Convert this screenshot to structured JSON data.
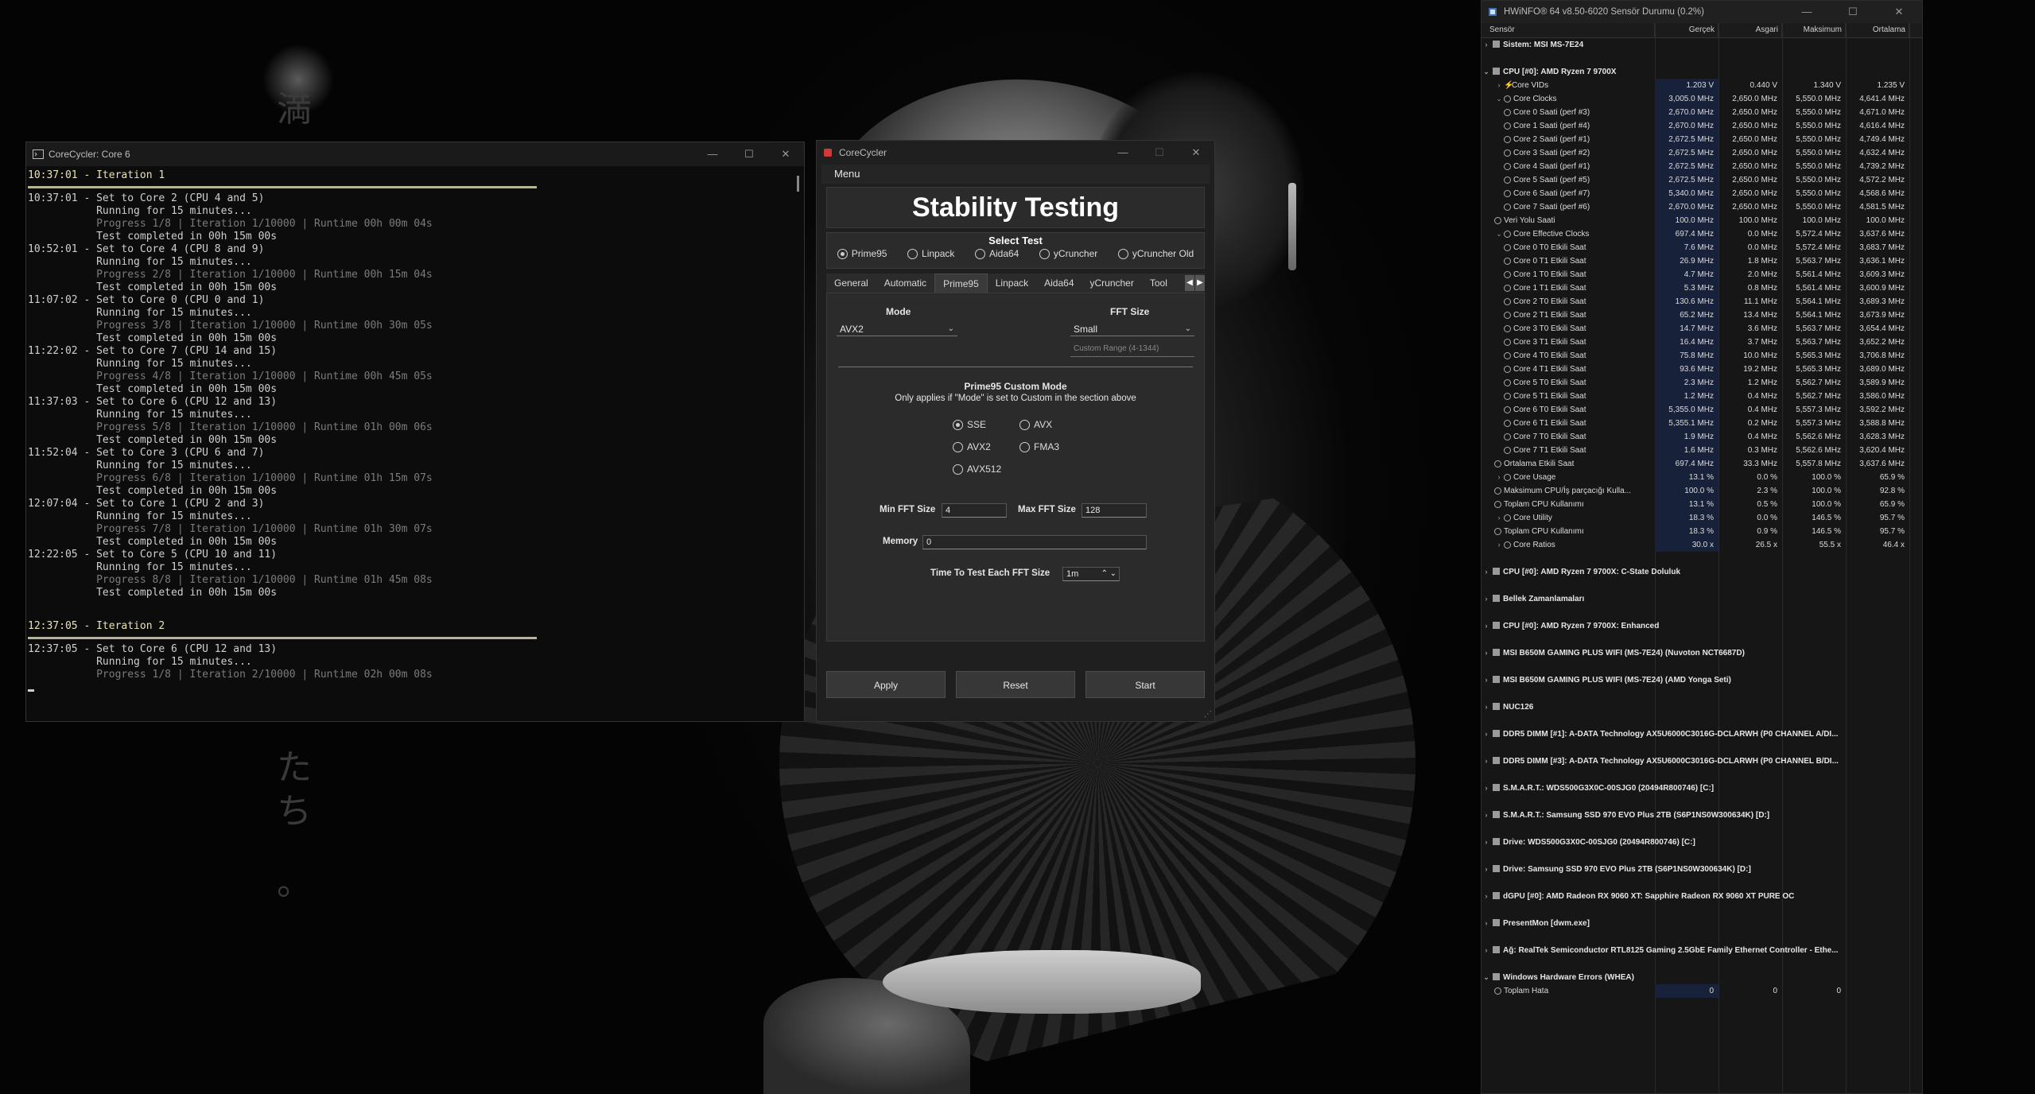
{
  "wallpaper": {
    "kanji": [
      "満",
      "た",
      "ち",
      "。"
    ]
  },
  "console": {
    "title": "CoreCycler: Core 6",
    "blocks": [
      {
        "type": "iter",
        "text": "10:37:01 - Iteration 1"
      },
      {
        "type": "sep"
      },
      {
        "type": "line",
        "text": "10:37:01 - Set to Core 2 (CPU 4 and 5)"
      },
      {
        "type": "line",
        "text": "           Running for 15 minutes..."
      },
      {
        "type": "dim",
        "text": "           Progress 1/8 | Iteration 1/10000 | Runtime 00h 00m 04s"
      },
      {
        "type": "line",
        "text": "           Test completed in 00h 15m 00s"
      },
      {
        "type": "line",
        "text": "10:52:01 - Set to Core 4 (CPU 8 and 9)"
      },
      {
        "type": "line",
        "text": "           Running for 15 minutes..."
      },
      {
        "type": "dim",
        "text": "           Progress 2/8 | Iteration 1/10000 | Runtime 00h 15m 04s"
      },
      {
        "type": "line",
        "text": "           Test completed in 00h 15m 00s"
      },
      {
        "type": "line",
        "text": "11:07:02 - Set to Core 0 (CPU 0 and 1)"
      },
      {
        "type": "line",
        "text": "           Running for 15 minutes..."
      },
      {
        "type": "dim",
        "text": "           Progress 3/8 | Iteration 1/10000 | Runtime 00h 30m 05s"
      },
      {
        "type": "line",
        "text": "           Test completed in 00h 15m 00s"
      },
      {
        "type": "line",
        "text": "11:22:02 - Set to Core 7 (CPU 14 and 15)"
      },
      {
        "type": "line",
        "text": "           Running for 15 minutes..."
      },
      {
        "type": "dim",
        "text": "           Progress 4/8 | Iteration 1/10000 | Runtime 00h 45m 05s"
      },
      {
        "type": "line",
        "text": "           Test completed in 00h 15m 00s"
      },
      {
        "type": "line",
        "text": "11:37:03 - Set to Core 6 (CPU 12 and 13)"
      },
      {
        "type": "line",
        "text": "           Running for 15 minutes..."
      },
      {
        "type": "dim",
        "text": "           Progress 5/8 | Iteration 1/10000 | Runtime 01h 00m 06s"
      },
      {
        "type": "line",
        "text": "           Test completed in 00h 15m 00s"
      },
      {
        "type": "line",
        "text": "11:52:04 - Set to Core 3 (CPU 6 and 7)"
      },
      {
        "type": "line",
        "text": "           Running for 15 minutes..."
      },
      {
        "type": "dim",
        "text": "           Progress 6/8 | Iteration 1/10000 | Runtime 01h 15m 07s"
      },
      {
        "type": "line",
        "text": "           Test completed in 00h 15m 00s"
      },
      {
        "type": "line",
        "text": "12:07:04 - Set to Core 1 (CPU 2 and 3)"
      },
      {
        "type": "line",
        "text": "           Running for 15 minutes..."
      },
      {
        "type": "dim",
        "text": "           Progress 7/8 | Iteration 1/10000 | Runtime 01h 30m 07s"
      },
      {
        "type": "line",
        "text": "           Test completed in 00h 15m 00s"
      },
      {
        "type": "line",
        "text": "12:22:05 - Set to Core 5 (CPU 10 and 11)"
      },
      {
        "type": "line",
        "text": "           Running for 15 minutes..."
      },
      {
        "type": "dim",
        "text": "           Progress 8/8 | Iteration 1/10000 | Runtime 01h 45m 08s"
      },
      {
        "type": "line",
        "text": "           Test completed in 00h 15m 00s"
      },
      {
        "type": "blank"
      },
      {
        "type": "iter",
        "text": "12:37:05 - Iteration 2"
      },
      {
        "type": "sep"
      },
      {
        "type": "line",
        "text": "12:37:05 - Set to Core 6 (CPU 12 and 13)"
      },
      {
        "type": "line",
        "text": "           Running for 15 minutes..."
      },
      {
        "type": "dim",
        "text": "           Progress 1/8 | Iteration 2/10000 | Runtime 02h 00m 08s"
      }
    ]
  },
  "corecycler": {
    "title": "CoreCycler",
    "menu": "Menu",
    "heading": "Stability Testing",
    "select_test_label": "Select Test",
    "tests": [
      {
        "label": "Prime95",
        "selected": true
      },
      {
        "label": "Linpack",
        "selected": false
      },
      {
        "label": "Aida64",
        "selected": false
      },
      {
        "label": "yCruncher",
        "selected": false
      },
      {
        "label": "yCruncher Old",
        "selected": false
      }
    ],
    "tabs": [
      {
        "label": "General",
        "active": false
      },
      {
        "label": "Automatic",
        "active": false
      },
      {
        "label": "Prime95",
        "active": true
      },
      {
        "label": "Linpack",
        "active": false
      },
      {
        "label": "Aida64",
        "active": false
      },
      {
        "label": "yCruncher",
        "active": false
      },
      {
        "label": "Tool",
        "active": false
      }
    ],
    "mode_label": "Mode",
    "mode_value": "AVX2",
    "fft_label": "FFT Size",
    "fft_value": "Small",
    "custom_range_placeholder": "Custom Range (4-1344)",
    "custom_mode_title": "Prime95 Custom Mode",
    "custom_mode_note": "Only applies if \"Mode\" is set to Custom in the section above",
    "instr": [
      {
        "label": "SSE",
        "selected": true
      },
      {
        "label": "AVX",
        "selected": false
      },
      {
        "label": "AVX2",
        "selected": false
      },
      {
        "label": "FMA3",
        "selected": false
      },
      {
        "label": "AVX512",
        "selected": false
      }
    ],
    "min_fft_label": "Min FFT Size",
    "min_fft_value": "4",
    "max_fft_label": "Max FFT Size",
    "max_fft_value": "128",
    "memory_label": "Memory",
    "memory_value": "0",
    "time_label": "Time To Test Each FFT Size",
    "time_value": "1m",
    "buttons": {
      "apply": "Apply",
      "reset": "Reset",
      "start": "Start"
    }
  },
  "hwinfo": {
    "title": "HWiNFO® 64 v8.50-6020 Sensör Durumu (0.2%)",
    "columns": [
      "Sensör",
      "Gerçek",
      "Asgari",
      "Maksimum",
      "Ortalama"
    ],
    "rows": [
      {
        "kind": "sec",
        "name": "Sistem: MSI MS-7E24",
        "expand": "›"
      },
      {
        "kind": "sec",
        "name": "CPU [#0]: AMD Ryzen 7 9700X",
        "expand": "⌄"
      },
      {
        "kind": "row",
        "indent": 1,
        "icon": "bolt",
        "expand": "›",
        "name": "Core VIDs",
        "vals": [
          "1.203 V",
          "0.440 V",
          "1.340 V",
          "1.235 V"
        ]
      },
      {
        "kind": "row",
        "indent": 1,
        "icon": "clock",
        "expand": "⌄",
        "name": "Core Clocks",
        "vals": [
          "3,005.0 MHz",
          "2,650.0 MHz",
          "5,550.0 MHz",
          "4,641.4 MHz"
        ]
      },
      {
        "kind": "row",
        "indent": 2,
        "icon": "clock",
        "name": "Core 0 Saati (perf #3)",
        "vals": [
          "2,670.0 MHz",
          "2,650.0 MHz",
          "5,550.0 MHz",
          "4,671.0 MHz"
        ]
      },
      {
        "kind": "row",
        "indent": 2,
        "icon": "clock",
        "name": "Core 1 Saati (perf #4)",
        "vals": [
          "2,670.0 MHz",
          "2,650.0 MHz",
          "5,550.0 MHz",
          "4,616.4 MHz"
        ]
      },
      {
        "kind": "row",
        "indent": 2,
        "icon": "clock",
        "name": "Core 2 Saati (perf #1)",
        "vals": [
          "2,672.5 MHz",
          "2,650.0 MHz",
          "5,550.0 MHz",
          "4,749.4 MHz"
        ]
      },
      {
        "kind": "row",
        "indent": 2,
        "icon": "clock",
        "name": "Core 3 Saati (perf #2)",
        "vals": [
          "2,672.5 MHz",
          "2,650.0 MHz",
          "5,550.0 MHz",
          "4,632.4 MHz"
        ]
      },
      {
        "kind": "row",
        "indent": 2,
        "icon": "clock",
        "name": "Core 4 Saati (perf #1)",
        "vals": [
          "2,672.5 MHz",
          "2,650.0 MHz",
          "5,550.0 MHz",
          "4,739.2 MHz"
        ]
      },
      {
        "kind": "row",
        "indent": 2,
        "icon": "clock",
        "name": "Core 5 Saati (perf #5)",
        "vals": [
          "2,672.5 MHz",
          "2,650.0 MHz",
          "5,550.0 MHz",
          "4,572.2 MHz"
        ]
      },
      {
        "kind": "row",
        "indent": 2,
        "icon": "clock",
        "name": "Core 6 Saati (perf #7)",
        "vals": [
          "5,340.0 MHz",
          "2,650.0 MHz",
          "5,550.0 MHz",
          "4,568.6 MHz"
        ]
      },
      {
        "kind": "row",
        "indent": 2,
        "icon": "clock",
        "name": "Core 7 Saati (perf #6)",
        "vals": [
          "2,670.0 MHz",
          "2,650.0 MHz",
          "5,550.0 MHz",
          "4,581.5 MHz"
        ]
      },
      {
        "kind": "row",
        "indent": 1,
        "icon": "clock",
        "name": "Veri Yolu Saati",
        "vals": [
          "100.0 MHz",
          "100.0 MHz",
          "100.0 MHz",
          "100.0 MHz"
        ]
      },
      {
        "kind": "row",
        "indent": 1,
        "icon": "clock",
        "expand": "⌄",
        "name": "Core Effective Clocks",
        "vals": [
          "697.4 MHz",
          "0.0 MHz",
          "5,572.4 MHz",
          "3,637.6 MHz"
        ]
      },
      {
        "kind": "row",
        "indent": 2,
        "icon": "clock",
        "name": "Core 0 T0 Etkili Saat",
        "vals": [
          "7.6 MHz",
          "0.0 MHz",
          "5,572.4 MHz",
          "3,683.7 MHz"
        ]
      },
      {
        "kind": "row",
        "indent": 2,
        "icon": "clock",
        "name": "Core 0 T1 Etkili Saat",
        "vals": [
          "26.9 MHz",
          "1.8 MHz",
          "5,563.7 MHz",
          "3,636.1 MHz"
        ]
      },
      {
        "kind": "row",
        "indent": 2,
        "icon": "clock",
        "name": "Core 1 T0 Etkili Saat",
        "vals": [
          "4.7 MHz",
          "2.0 MHz",
          "5,561.4 MHz",
          "3,609.3 MHz"
        ]
      },
      {
        "kind": "row",
        "indent": 2,
        "icon": "clock",
        "name": "Core 1 T1 Etkili Saat",
        "vals": [
          "5.3 MHz",
          "0.8 MHz",
          "5,561.4 MHz",
          "3,600.9 MHz"
        ]
      },
      {
        "kind": "row",
        "indent": 2,
        "icon": "clock",
        "name": "Core 2 T0 Etkili Saat",
        "vals": [
          "130.6 MHz",
          "11.1 MHz",
          "5,564.1 MHz",
          "3,689.3 MHz"
        ]
      },
      {
        "kind": "row",
        "indent": 2,
        "icon": "clock",
        "name": "Core 2 T1 Etkili Saat",
        "vals": [
          "65.2 MHz",
          "13.4 MHz",
          "5,564.1 MHz",
          "3,673.9 MHz"
        ]
      },
      {
        "kind": "row",
        "indent": 2,
        "icon": "clock",
        "name": "Core 3 T0 Etkili Saat",
        "vals": [
          "14.7 MHz",
          "3.6 MHz",
          "5,563.7 MHz",
          "3,654.4 MHz"
        ]
      },
      {
        "kind": "row",
        "indent": 2,
        "icon": "clock",
        "name": "Core 3 T1 Etkili Saat",
        "vals": [
          "16.4 MHz",
          "3.7 MHz",
          "5,563.7 MHz",
          "3,652.2 MHz"
        ]
      },
      {
        "kind": "row",
        "indent": 2,
        "icon": "clock",
        "name": "Core 4 T0 Etkili Saat",
        "vals": [
          "75.8 MHz",
          "10.0 MHz",
          "5,565.3 MHz",
          "3,706.8 MHz"
        ]
      },
      {
        "kind": "row",
        "indent": 2,
        "icon": "clock",
        "name": "Core 4 T1 Etkili Saat",
        "vals": [
          "93.6 MHz",
          "19.2 MHz",
          "5,565.3 MHz",
          "3,689.0 MHz"
        ]
      },
      {
        "kind": "row",
        "indent": 2,
        "icon": "clock",
        "name": "Core 5 T0 Etkili Saat",
        "vals": [
          "2.3 MHz",
          "1.2 MHz",
          "5,562.7 MHz",
          "3,589.9 MHz"
        ]
      },
      {
        "kind": "row",
        "indent": 2,
        "icon": "clock",
        "name": "Core 5 T1 Etkili Saat",
        "vals": [
          "1.2 MHz",
          "0.4 MHz",
          "5,562.7 MHz",
          "3,586.0 MHz"
        ]
      },
      {
        "kind": "row",
        "indent": 2,
        "icon": "clock",
        "name": "Core 6 T0 Etkili Saat",
        "vals": [
          "5,355.0 MHz",
          "0.4 MHz",
          "5,557.3 MHz",
          "3,592.2 MHz"
        ]
      },
      {
        "kind": "row",
        "indent": 2,
        "icon": "clock",
        "name": "Core 6 T1 Etkili Saat",
        "vals": [
          "5,355.1 MHz",
          "0.2 MHz",
          "5,557.3 MHz",
          "3,588.8 MHz"
        ]
      },
      {
        "kind": "row",
        "indent": 2,
        "icon": "clock",
        "name": "Core 7 T0 Etkili Saat",
        "vals": [
          "1.9 MHz",
          "0.4 MHz",
          "5,562.6 MHz",
          "3,628.3 MHz"
        ]
      },
      {
        "kind": "row",
        "indent": 2,
        "icon": "clock",
        "name": "Core 7 T1 Etkili Saat",
        "vals": [
          "1.6 MHz",
          "0.3 MHz",
          "5,562.6 MHz",
          "3,620.4 MHz"
        ]
      },
      {
        "kind": "row",
        "indent": 1,
        "icon": "clock",
        "name": "Ortalama Etkili Saat",
        "vals": [
          "697.4 MHz",
          "33.3 MHz",
          "5,557.8 MHz",
          "3,637.6 MHz"
        ]
      },
      {
        "kind": "row",
        "indent": 1,
        "icon": "clock",
        "expand": "›",
        "name": "Core Usage",
        "vals": [
          "13.1 %",
          "0.0 %",
          "100.0 %",
          "65.9 %"
        ]
      },
      {
        "kind": "row",
        "indent": 1,
        "icon": "clock",
        "name": "Maksimum CPU/İş parçacığı Kulla...",
        "vals": [
          "100.0 %",
          "2.3 %",
          "100.0 %",
          "92.8 %"
        ]
      },
      {
        "kind": "row",
        "indent": 1,
        "icon": "clock",
        "name": "Toplam CPU Kullanımı",
        "vals": [
          "13.1 %",
          "0.5 %",
          "100.0 %",
          "65.9 %"
        ]
      },
      {
        "kind": "row",
        "indent": 1,
        "icon": "clock",
        "expand": "›",
        "name": "Core Utility",
        "vals": [
          "18.3 %",
          "0.0 %",
          "146.5 %",
          "95.7 %"
        ]
      },
      {
        "kind": "row",
        "indent": 1,
        "icon": "clock",
        "name": "Toplam CPU Kullanımı",
        "vals": [
          "18.3 %",
          "0.9 %",
          "146.5 %",
          "95.7 %"
        ]
      },
      {
        "kind": "row",
        "indent": 1,
        "icon": "clock",
        "expand": "›",
        "name": "Core Ratios",
        "vals": [
          "30.0 x",
          "26.5 x",
          "55.5 x",
          "46.4 x"
        ]
      },
      {
        "kind": "sec",
        "name": "CPU [#0]: AMD Ryzen 7 9700X: C-State Doluluk",
        "expand": "›"
      },
      {
        "kind": "sec",
        "name": "Bellek Zamanlamaları",
        "expand": "›"
      },
      {
        "kind": "sec",
        "name": "CPU [#0]: AMD Ryzen 7 9700X: Enhanced",
        "expand": "›"
      },
      {
        "kind": "sec",
        "name": "MSI B650M GAMING PLUS WIFI (MS-7E24) (Nuvoton NCT6687D)",
        "expand": "›"
      },
      {
        "kind": "sec",
        "name": "MSI B650M GAMING PLUS WIFI (MS-7E24) (AMD Yonga Seti)",
        "expand": "›"
      },
      {
        "kind": "sec",
        "name": "NUC126",
        "expand": "›"
      },
      {
        "kind": "sec",
        "name": "DDR5 DIMM [#1]: A-DATA Technology AX5U6000C3016G-DCLARWH (P0 CHANNEL A/DI...",
        "expand": "›"
      },
      {
        "kind": "sec",
        "name": "DDR5 DIMM [#3]: A-DATA Technology AX5U6000C3016G-DCLARWH (P0 CHANNEL B/DI...",
        "expand": "›"
      },
      {
        "kind": "sec",
        "name": "S.M.A.R.T.: WDS500G3X0C-00SJG0 (20494R800746) [C:]",
        "expand": "›"
      },
      {
        "kind": "sec",
        "name": "S.M.A.R.T.: Samsung SSD 970 EVO Plus 2TB (S6P1NS0W300634K) [D:]",
        "expand": "›"
      },
      {
        "kind": "sec",
        "name": "Drive: WDS500G3X0C-00SJG0 (20494R800746) [C:]",
        "expand": "›"
      },
      {
        "kind": "sec",
        "name": "Drive: Samsung SSD 970 EVO Plus 2TB (S6P1NS0W300634K) [D:]",
        "expand": "›"
      },
      {
        "kind": "sec",
        "name": "dGPU [#0]: AMD Radeon RX 9060 XT: Sapphire Radeon RX 9060 XT PURE OC",
        "expand": "›"
      },
      {
        "kind": "sec",
        "name": "PresentMon [dwm.exe]",
        "expand": "›"
      },
      {
        "kind": "sec",
        "name": "Ağ: RealTek Semiconductor RTL8125 Gaming 2.5GbE Family Ethernet Controller - Ethe...",
        "expand": "›"
      },
      {
        "kind": "sec",
        "name": "Windows Hardware Errors (WHEA)",
        "expand": "⌄"
      },
      {
        "kind": "row",
        "indent": 1,
        "icon": "clock",
        "name": "Toplam Hata",
        "vals": [
          "0",
          "0",
          "0",
          ""
        ]
      }
    ]
  }
}
